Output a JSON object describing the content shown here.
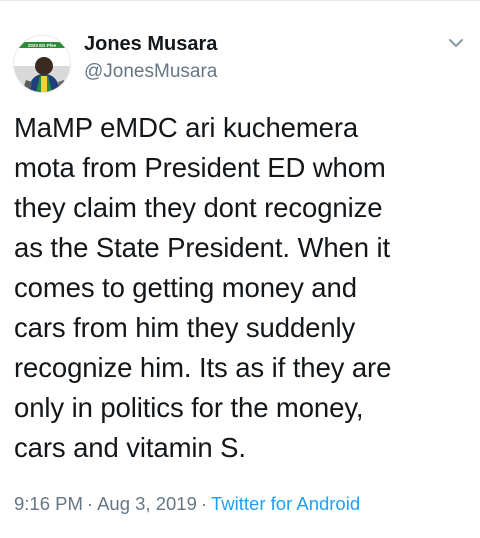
{
  "tweet": {
    "author": {
      "display_name": "Jones Musara",
      "handle": "@JonesMusara",
      "avatar_label": "2023 ED Pfee"
    },
    "text": "MaMP eMDC  ari kuchemera\nmota from President ED whom\nthey claim they dont recognize\nas the State President. When it\ncomes to getting money and\ncars from him they suddenly\nrecognize him. Its as if they are\nonly  in politics for the money,\ncars and vitamin S.",
    "time": "9:16 PM",
    "date": "Aug 3, 2019",
    "separator": "·",
    "source": "Twitter for Android"
  },
  "colors": {
    "text_primary": "#14171a",
    "text_secondary": "#657786",
    "link": "#1da1f2",
    "avatar_band": "#2e8b3a"
  },
  "icons": {
    "menu": "chevron-down-icon"
  }
}
